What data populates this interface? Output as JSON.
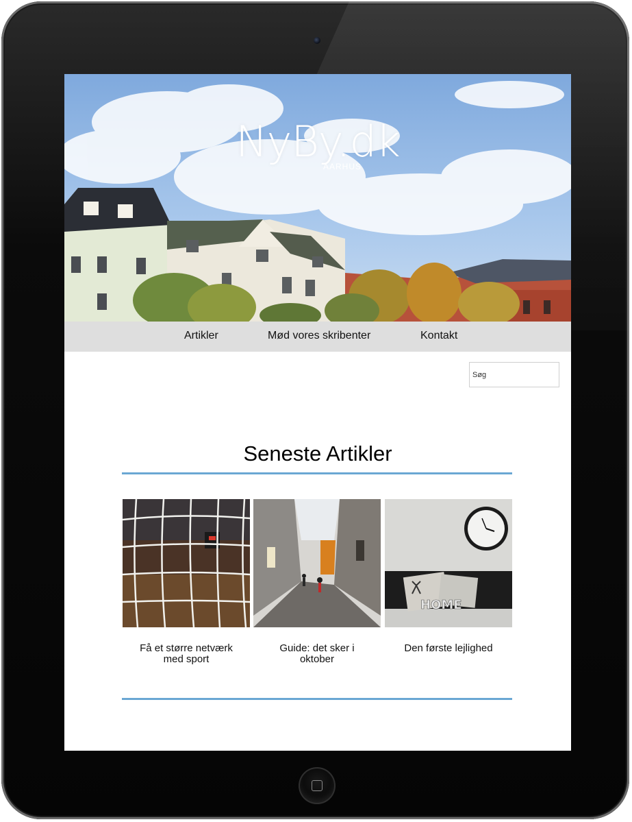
{
  "site": {
    "logo_text": "NyBy.dk",
    "logo_subtext": "AARHUS"
  },
  "nav": {
    "items": [
      "Artikler",
      "Mød vores skribenter",
      "Kontakt"
    ]
  },
  "search": {
    "placeholder": "Søg"
  },
  "main": {
    "section_title": "Seneste Artikler",
    "articles": [
      {
        "title": "Få et større netværk med sport",
        "image": "sports-hall-net-photo"
      },
      {
        "title": "Guide: det sker i oktober",
        "image": "cobblestone-street-photo"
      },
      {
        "title": "Den første lejlighed",
        "image": "living-room-clock-photo"
      }
    ]
  },
  "colors": {
    "accent_rule": "#6aa7d3",
    "nav_background": "#dedede",
    "sky": "#9fc3ea"
  },
  "device": {
    "home_icon": "home-button-icon",
    "camera_icon": "camera-icon"
  }
}
